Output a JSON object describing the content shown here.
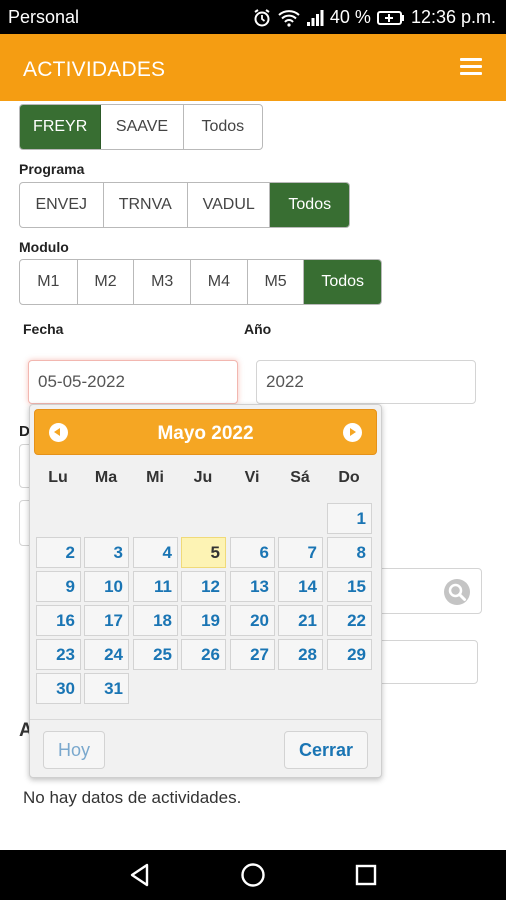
{
  "status_bar": {
    "carrier": "Personal",
    "battery": "40 %",
    "time": "12:36 p.m."
  },
  "app_bar": {
    "title": "ACTIVIDADES",
    "menu_icon": "hamburger-menu-icon"
  },
  "filters": {
    "group_options": [
      "FREYR",
      "SAAVE",
      "Todos"
    ],
    "group_selected": "FREYR",
    "programa_label": "Programa",
    "programa_options": [
      "ENVEJ",
      "TRNVA",
      "VADUL",
      "Todos"
    ],
    "programa_selected": "Todos",
    "modulo_label": "Modulo",
    "modulo_options": [
      "M1",
      "M2",
      "M3",
      "M4",
      "M5",
      "Todos"
    ],
    "modulo_selected": "Todos"
  },
  "fields": {
    "fecha_label": "Fecha",
    "fecha_value": "05-05-2022",
    "anio_label": "Año",
    "anio_value": "2022",
    "partial_label": "D",
    "section_partial": "A",
    "search_icon": "search-icon"
  },
  "calendar": {
    "month_label": "Mayo 2022",
    "weekdays": [
      "Lu",
      "Ma",
      "Mi",
      "Ju",
      "Vi",
      "Sá",
      "Do"
    ],
    "first_weekday_index": 6,
    "days_in_month": 31,
    "selected_day": 5,
    "today_button": "Hoy",
    "close_button": "Cerrar"
  },
  "content": {
    "empty_message": "No hay datos de actividades."
  }
}
